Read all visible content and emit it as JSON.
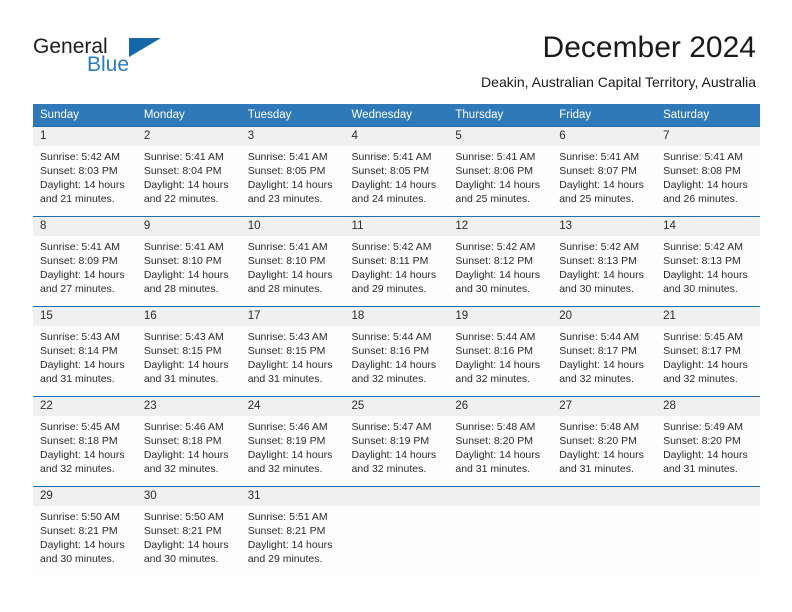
{
  "brand": {
    "name_top": "General",
    "name_bottom": "Blue",
    "accent_color": "#2a7ec0",
    "triangle_color": "#1567a8"
  },
  "header": {
    "title": "December 2024",
    "subtitle": "Deakin, Australian Capital Territory, Australia"
  },
  "calendar": {
    "header_bg": "#3079b8",
    "weekday_headers": [
      "Sunday",
      "Monday",
      "Tuesday",
      "Wednesday",
      "Thursday",
      "Friday",
      "Saturday"
    ],
    "weeks": [
      [
        {
          "day": "1",
          "sunrise": "Sunrise: 5:42 AM",
          "sunset": "Sunset: 8:03 PM",
          "daylight_1": "Daylight: 14 hours",
          "daylight_2": "and 21 minutes."
        },
        {
          "day": "2",
          "sunrise": "Sunrise: 5:41 AM",
          "sunset": "Sunset: 8:04 PM",
          "daylight_1": "Daylight: 14 hours",
          "daylight_2": "and 22 minutes."
        },
        {
          "day": "3",
          "sunrise": "Sunrise: 5:41 AM",
          "sunset": "Sunset: 8:05 PM",
          "daylight_1": "Daylight: 14 hours",
          "daylight_2": "and 23 minutes."
        },
        {
          "day": "4",
          "sunrise": "Sunrise: 5:41 AM",
          "sunset": "Sunset: 8:05 PM",
          "daylight_1": "Daylight: 14 hours",
          "daylight_2": "and 24 minutes."
        },
        {
          "day": "5",
          "sunrise": "Sunrise: 5:41 AM",
          "sunset": "Sunset: 8:06 PM",
          "daylight_1": "Daylight: 14 hours",
          "daylight_2": "and 25 minutes."
        },
        {
          "day": "6",
          "sunrise": "Sunrise: 5:41 AM",
          "sunset": "Sunset: 8:07 PM",
          "daylight_1": "Daylight: 14 hours",
          "daylight_2": "and 25 minutes."
        },
        {
          "day": "7",
          "sunrise": "Sunrise: 5:41 AM",
          "sunset": "Sunset: 8:08 PM",
          "daylight_1": "Daylight: 14 hours",
          "daylight_2": "and 26 minutes."
        }
      ],
      [
        {
          "day": "8",
          "sunrise": "Sunrise: 5:41 AM",
          "sunset": "Sunset: 8:09 PM",
          "daylight_1": "Daylight: 14 hours",
          "daylight_2": "and 27 minutes."
        },
        {
          "day": "9",
          "sunrise": "Sunrise: 5:41 AM",
          "sunset": "Sunset: 8:10 PM",
          "daylight_1": "Daylight: 14 hours",
          "daylight_2": "and 28 minutes."
        },
        {
          "day": "10",
          "sunrise": "Sunrise: 5:41 AM",
          "sunset": "Sunset: 8:10 PM",
          "daylight_1": "Daylight: 14 hours",
          "daylight_2": "and 28 minutes."
        },
        {
          "day": "11",
          "sunrise": "Sunrise: 5:42 AM",
          "sunset": "Sunset: 8:11 PM",
          "daylight_1": "Daylight: 14 hours",
          "daylight_2": "and 29 minutes."
        },
        {
          "day": "12",
          "sunrise": "Sunrise: 5:42 AM",
          "sunset": "Sunset: 8:12 PM",
          "daylight_1": "Daylight: 14 hours",
          "daylight_2": "and 30 minutes."
        },
        {
          "day": "13",
          "sunrise": "Sunrise: 5:42 AM",
          "sunset": "Sunset: 8:13 PM",
          "daylight_1": "Daylight: 14 hours",
          "daylight_2": "and 30 minutes."
        },
        {
          "day": "14",
          "sunrise": "Sunrise: 5:42 AM",
          "sunset": "Sunset: 8:13 PM",
          "daylight_1": "Daylight: 14 hours",
          "daylight_2": "and 30 minutes."
        }
      ],
      [
        {
          "day": "15",
          "sunrise": "Sunrise: 5:43 AM",
          "sunset": "Sunset: 8:14 PM",
          "daylight_1": "Daylight: 14 hours",
          "daylight_2": "and 31 minutes."
        },
        {
          "day": "16",
          "sunrise": "Sunrise: 5:43 AM",
          "sunset": "Sunset: 8:15 PM",
          "daylight_1": "Daylight: 14 hours",
          "daylight_2": "and 31 minutes."
        },
        {
          "day": "17",
          "sunrise": "Sunrise: 5:43 AM",
          "sunset": "Sunset: 8:15 PM",
          "daylight_1": "Daylight: 14 hours",
          "daylight_2": "and 31 minutes."
        },
        {
          "day": "18",
          "sunrise": "Sunrise: 5:44 AM",
          "sunset": "Sunset: 8:16 PM",
          "daylight_1": "Daylight: 14 hours",
          "daylight_2": "and 32 minutes."
        },
        {
          "day": "19",
          "sunrise": "Sunrise: 5:44 AM",
          "sunset": "Sunset: 8:16 PM",
          "daylight_1": "Daylight: 14 hours",
          "daylight_2": "and 32 minutes."
        },
        {
          "day": "20",
          "sunrise": "Sunrise: 5:44 AM",
          "sunset": "Sunset: 8:17 PM",
          "daylight_1": "Daylight: 14 hours",
          "daylight_2": "and 32 minutes."
        },
        {
          "day": "21",
          "sunrise": "Sunrise: 5:45 AM",
          "sunset": "Sunset: 8:17 PM",
          "daylight_1": "Daylight: 14 hours",
          "daylight_2": "and 32 minutes."
        }
      ],
      [
        {
          "day": "22",
          "sunrise": "Sunrise: 5:45 AM",
          "sunset": "Sunset: 8:18 PM",
          "daylight_1": "Daylight: 14 hours",
          "daylight_2": "and 32 minutes."
        },
        {
          "day": "23",
          "sunrise": "Sunrise: 5:46 AM",
          "sunset": "Sunset: 8:18 PM",
          "daylight_1": "Daylight: 14 hours",
          "daylight_2": "and 32 minutes."
        },
        {
          "day": "24",
          "sunrise": "Sunrise: 5:46 AM",
          "sunset": "Sunset: 8:19 PM",
          "daylight_1": "Daylight: 14 hours",
          "daylight_2": "and 32 minutes."
        },
        {
          "day": "25",
          "sunrise": "Sunrise: 5:47 AM",
          "sunset": "Sunset: 8:19 PM",
          "daylight_1": "Daylight: 14 hours",
          "daylight_2": "and 32 minutes."
        },
        {
          "day": "26",
          "sunrise": "Sunrise: 5:48 AM",
          "sunset": "Sunset: 8:20 PM",
          "daylight_1": "Daylight: 14 hours",
          "daylight_2": "and 31 minutes."
        },
        {
          "day": "27",
          "sunrise": "Sunrise: 5:48 AM",
          "sunset": "Sunset: 8:20 PM",
          "daylight_1": "Daylight: 14 hours",
          "daylight_2": "and 31 minutes."
        },
        {
          "day": "28",
          "sunrise": "Sunrise: 5:49 AM",
          "sunset": "Sunset: 8:20 PM",
          "daylight_1": "Daylight: 14 hours",
          "daylight_2": "and 31 minutes."
        }
      ],
      [
        {
          "day": "29",
          "sunrise": "Sunrise: 5:50 AM",
          "sunset": "Sunset: 8:21 PM",
          "daylight_1": "Daylight: 14 hours",
          "daylight_2": "and 30 minutes."
        },
        {
          "day": "30",
          "sunrise": "Sunrise: 5:50 AM",
          "sunset": "Sunset: 8:21 PM",
          "daylight_1": "Daylight: 14 hours",
          "daylight_2": "and 30 minutes."
        },
        {
          "day": "31",
          "sunrise": "Sunrise: 5:51 AM",
          "sunset": "Sunset: 8:21 PM",
          "daylight_1": "Daylight: 14 hours",
          "daylight_2": "and 29 minutes."
        },
        {
          "day": "",
          "sunrise": "",
          "sunset": "",
          "daylight_1": "",
          "daylight_2": ""
        },
        {
          "day": "",
          "sunrise": "",
          "sunset": "",
          "daylight_1": "",
          "daylight_2": ""
        },
        {
          "day": "",
          "sunrise": "",
          "sunset": "",
          "daylight_1": "",
          "daylight_2": ""
        },
        {
          "day": "",
          "sunrise": "",
          "sunset": "",
          "daylight_1": "",
          "daylight_2": ""
        }
      ]
    ]
  }
}
